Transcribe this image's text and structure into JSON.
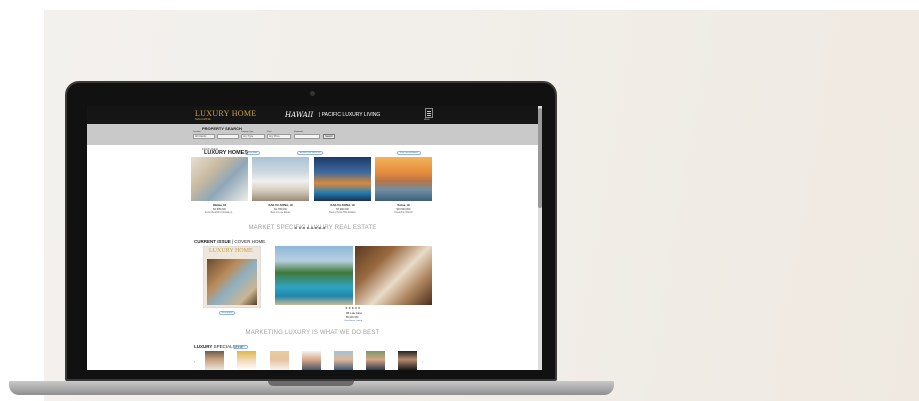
{
  "site": {
    "logo": "LUXURY HOME",
    "logo_sub": "MAGAZINE",
    "brand": "HAWAII",
    "tagline": "| PACIFIC LUXURY LIVING",
    "menu_label": "MENU"
  },
  "search": {
    "title": "PROPERTY SEARCH",
    "fields": [
      {
        "label": "Location",
        "value": "All Islands"
      },
      {
        "label": "",
        "value": ""
      },
      {
        "label": "Property Type",
        "value": "Any Type"
      },
      {
        "label": "Price",
        "value": "Any Price"
      },
      {
        "label": "Keywords",
        "value": ""
      }
    ],
    "button": "Search"
  },
  "featured": {
    "label": "FEATURED",
    "title": "LUXURY HOMES",
    "view_more": "View More",
    "advertise": "ADVERTISE WITH US",
    "view_listings": "View Luxury Homes",
    "cards": [
      {
        "location": "Wailea, HI",
        "price": "$2,995,000",
        "desc": "Iconic Beachfront Estate in..."
      },
      {
        "location": "KAILUA-KONA, HI",
        "price": "$1,799,000",
        "desc": "Best in Luxe Estate"
      },
      {
        "location": "KAILUA-KONA, HI",
        "price": "$7,990,000",
        "desc": "Best of Kona Hills Estates"
      },
      {
        "location": "Koloa, HI",
        "price": "$16,500,000",
        "desc": "Oceanfront Ranch"
      }
    ]
  },
  "headline1": "MARKET SPECIFIC LUXURY REAL ESTATE",
  "current_issue": {
    "title_bold": "CURRENT ISSUE",
    "title_rest": " | COVER HOME",
    "cover_logo": "LUXURY HOME",
    "cover_button": "Read online",
    "rating": "★★★★★",
    "location": "95 Lau Aina",
    "price": "$5,900,000",
    "link": "View Home Listing"
  },
  "headline2": "MARKETING LUXURY IS WHAT WE DO BEST",
  "specialists": {
    "title_bold": "LUXURY",
    "title_rest": " SPECIALISTS",
    "view_all": "View More",
    "prev": "‹",
    "next": "›",
    "count": 7
  },
  "colors": {
    "accent_gold": "#c9a24a",
    "link_blue": "#3b73b5",
    "search_bar": "#c9c9c9",
    "header_bg": "#151515"
  }
}
